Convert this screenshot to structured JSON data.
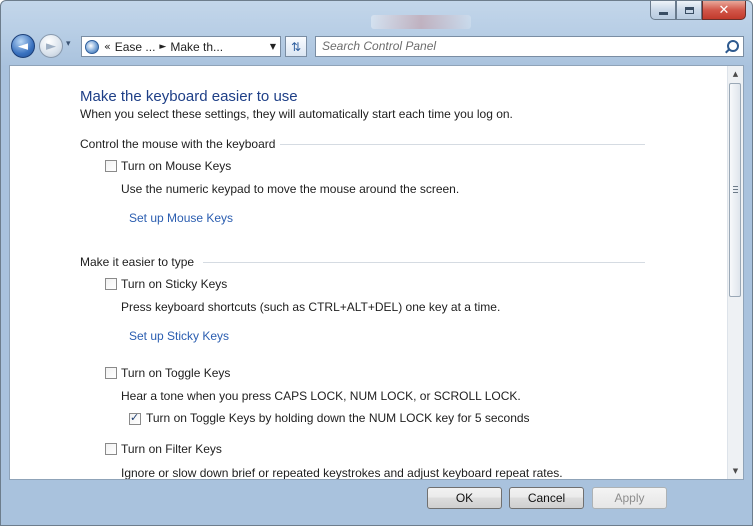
{
  "window": {
    "caption_buttons": {
      "minimize": "–",
      "maximize": "□",
      "close": "✕"
    }
  },
  "nav": {
    "back_glyph": "◄",
    "forward_glyph": "►",
    "history_glyph": "▾",
    "address_prefix": "«",
    "breadcrumbs": [
      "Ease ...",
      "Make th..."
    ],
    "breadcrumb_sep": "►",
    "address_dropdown": "▼",
    "refresh_glyph": "⇅",
    "search_placeholder": "Search Control Panel"
  },
  "main": {
    "title": "Make the keyboard easier to use",
    "subtitle": "When you select these settings, they will automatically start each time you log on.",
    "sections": [
      {
        "heading": "Control the mouse with the keyboard",
        "options": [
          {
            "label": "Turn on Mouse Keys",
            "checked": false,
            "description": "Use the numeric keypad to move the mouse around the screen.",
            "link": "Set up Mouse Keys"
          }
        ]
      },
      {
        "heading": "Make it easier to type",
        "options": [
          {
            "label": "Turn on Sticky Keys",
            "checked": false,
            "description": "Press keyboard shortcuts (such as CTRL+ALT+DEL) one key at a time.",
            "link": "Set up Sticky Keys"
          },
          {
            "label": "Turn on Toggle Keys",
            "checked": false,
            "description": "Hear a tone when you press CAPS LOCK, NUM LOCK, or SCROLL LOCK.",
            "suboption": {
              "label": "Turn on Toggle Keys by holding down the NUM LOCK key for 5 seconds",
              "checked": true
            }
          },
          {
            "label": "Turn on Filter Keys",
            "checked": false,
            "description": "Ignore or slow down brief or repeated keystrokes and adjust keyboard repeat rates."
          }
        ]
      }
    ]
  },
  "footer": {
    "ok": "OK",
    "cancel": "Cancel",
    "apply": "Apply",
    "apply_enabled": false
  },
  "scrollbar": {
    "up_glyph": "▲",
    "down_glyph": "▼"
  },
  "colors": {
    "title": "#1e3f87",
    "link": "#2a5db0",
    "frame": "#b9cfe6",
    "close_button": "#c23a2c"
  }
}
